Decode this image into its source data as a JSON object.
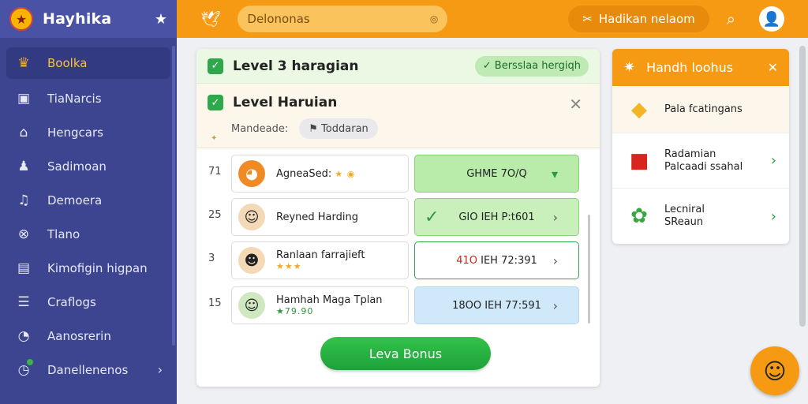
{
  "sidebar": {
    "brand": "Hayhika",
    "items": [
      {
        "label": "Boolka",
        "icon": "crown-icon",
        "glyph": "♛"
      },
      {
        "label": "TiaNarcis",
        "icon": "image-icon",
        "glyph": "▣"
      },
      {
        "label": "Hengcars",
        "icon": "home-icon",
        "glyph": "⌂"
      },
      {
        "label": "Sadimoan",
        "icon": "user-icon",
        "glyph": "♟"
      },
      {
        "label": "Demoera",
        "icon": "music-icon",
        "glyph": "♫"
      },
      {
        "label": "Tlano",
        "icon": "shield-icon",
        "glyph": "⊗"
      },
      {
        "label": "Kimofigin higpan",
        "icon": "window-icon",
        "glyph": "▤"
      },
      {
        "label": "Craflogs",
        "icon": "list-icon",
        "glyph": "☰"
      },
      {
        "label": "Aanosrerin",
        "icon": "badge-icon",
        "glyph": "◔"
      },
      {
        "label": "Danellenenos",
        "icon": "clock-icon",
        "glyph": "◷"
      }
    ]
  },
  "topbar": {
    "search_value": "Delononas",
    "action_label": "Hadikan nelaom"
  },
  "panel": {
    "level_title": "Level 3 haragian",
    "level_pill": "Bersslaa hergiqh",
    "sub_title": "Level Haruian",
    "meta_label": "Mandeade:",
    "meta_chip": "Toddaran",
    "rows": [
      {
        "rank": "71",
        "name": "AgneaSed:",
        "extra": "★ ◉",
        "score_a": "GHME 7O/Q",
        "score_b": "",
        "style": "green"
      },
      {
        "rank": "25",
        "name": "Reyned Harding",
        "extra": "",
        "score_a": "GIO",
        "score_b": "IEH P:t601",
        "style": "green2"
      },
      {
        "rank": "3",
        "name": "Ranlaan farrajieft",
        "extra": "★★★",
        "score_a": "41O",
        "score_b": "IEH 72:391",
        "style": "white"
      },
      {
        "rank": "15",
        "name": "Hamhah Maga Tplan",
        "extra": "★79.90",
        "score_a": "18OO",
        "score_b": "IEH 77:591",
        "style": "blue"
      }
    ],
    "bonus_button": "Leva Bonus"
  },
  "card": {
    "title": "Handh loohus",
    "items": [
      {
        "line1": "Pala fcatingans",
        "line2": ""
      },
      {
        "line1": "Radamian",
        "line2": "Palcaadi ssahal"
      },
      {
        "line1": "Lecniral",
        "line2": "SReaun"
      }
    ]
  },
  "colors": {
    "sidebar": "#3d4590",
    "topbar": "#f79a13",
    "accent_green": "#2ea84a",
    "accent_yellow": "#f9c23c"
  }
}
